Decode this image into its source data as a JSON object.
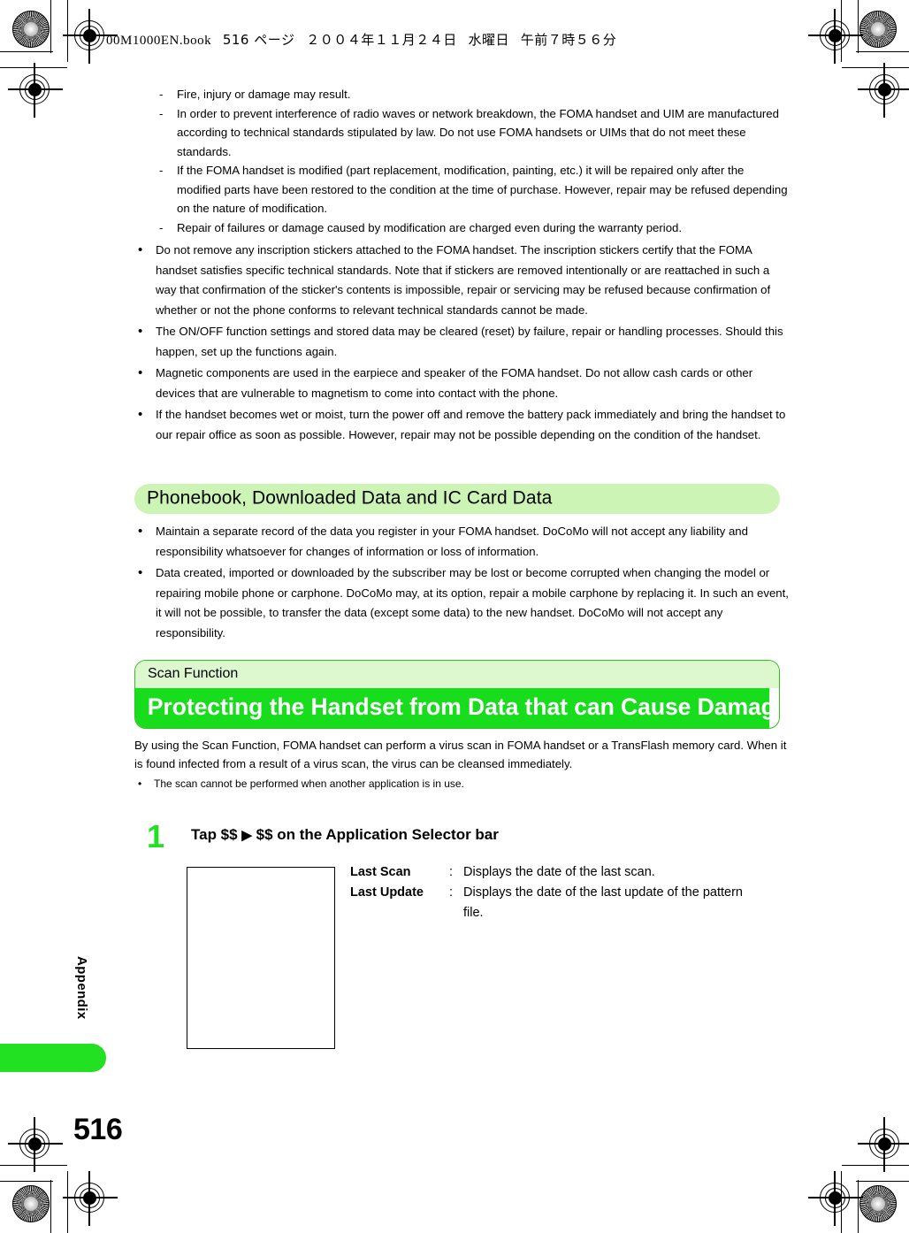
{
  "file_header": {
    "filename": "00M1000EN.book",
    "page_label": "516 ページ",
    "date": "２００４年１１月２４日",
    "weekday": "水曜日",
    "time": "午前７時５６分"
  },
  "colors": {
    "bright_green": "#18dd1d",
    "pale_green": "#ccf5b5",
    "kicker_green": "#ddf7cf",
    "step_green": "#22e022"
  },
  "top_dash_items": [
    "Fire, injury or damage may result.",
    "In order to prevent interference of radio waves or network breakdown, the FOMA handset and UIM are manufactured according to technical standards stipulated by law. Do not use FOMA handsets or UIMs that do not meet these standards.",
    "If the FOMA handset is modified (part replacement, modification, painting, etc.) it will be repaired only after the modified parts have been restored to the condition at the time of purchase. However, repair may be refused depending on the nature of modification.",
    "Repair of failures or damage caused by modification are charged even during the warranty period."
  ],
  "top_bullet_items": [
    "Do not remove any inscription stickers attached to the FOMA handset. The inscription stickers certify that the FOMA handset satisfies specific technical standards. Note that if stickers are removed intentionally or are reattached in such a way that confirmation of the sticker's contents is impossible, repair or servicing may be refused because confirmation of whether or not the phone conforms to relevant technical standards cannot be made.",
    "The ON/OFF function settings and stored data may be cleared (reset) by failure, repair or handling processes. Should this happen, set up the functions again.",
    "Magnetic components are used in the earpiece and speaker of the FOMA handset. Do not allow cash cards or other devices that are vulnerable to magnetism to come into contact with the phone.",
    "If the handset becomes wet or moist, turn the power off and remove the battery pack immediately and bring the handset to our repair office as soon as possible. However, repair may not be possible depending on the condition of the handset."
  ],
  "section_banner": {
    "label": "Phonebook, Downloaded Data and IC Card Data"
  },
  "section_bullet_items": [
    "Maintain a separate record of the data you register in your FOMA handset. DoCoMo will not accept any liability and responsibility whatsoever for changes of information or loss of information.",
    "Data created, imported or downloaded by the subscriber may be lost or become corrupted when changing the model or repairing mobile phone or carphone. DoCoMo may, at its option, repair a mobile carphone by replacing it. In such an event, it will not be possible, to transfer the data (except some data) to the new handset. DoCoMo will not accept any responsibility."
  ],
  "title_block": {
    "kicker": "Scan Function",
    "title": "Protecting the Handset from Data that can Cause Damage"
  },
  "intro": {
    "paragraph": "By using the Scan Function, FOMA handset can perform a virus scan in FOMA handset or a TransFlash memory card. When it is found infected from a result of a virus scan, the virus can be cleansed immediately.",
    "note": "The scan cannot be performed when another application is in use."
  },
  "step": {
    "number": "1",
    "text_before": "Tap $$",
    "arrow": "▶",
    "text_after": "$$ on the Application Selector bar"
  },
  "definitions": [
    {
      "term": "Last Scan",
      "separator": ":",
      "description": "Displays the date of the last scan."
    },
    {
      "term": "Last Update",
      "separator": ":",
      "description": "Displays the date of the last update of the pattern file."
    }
  ],
  "sidebar": {
    "tab_label": "Appendix"
  },
  "page_number": "516",
  "bullet_glyph": "•",
  "dash_glyph": "-"
}
